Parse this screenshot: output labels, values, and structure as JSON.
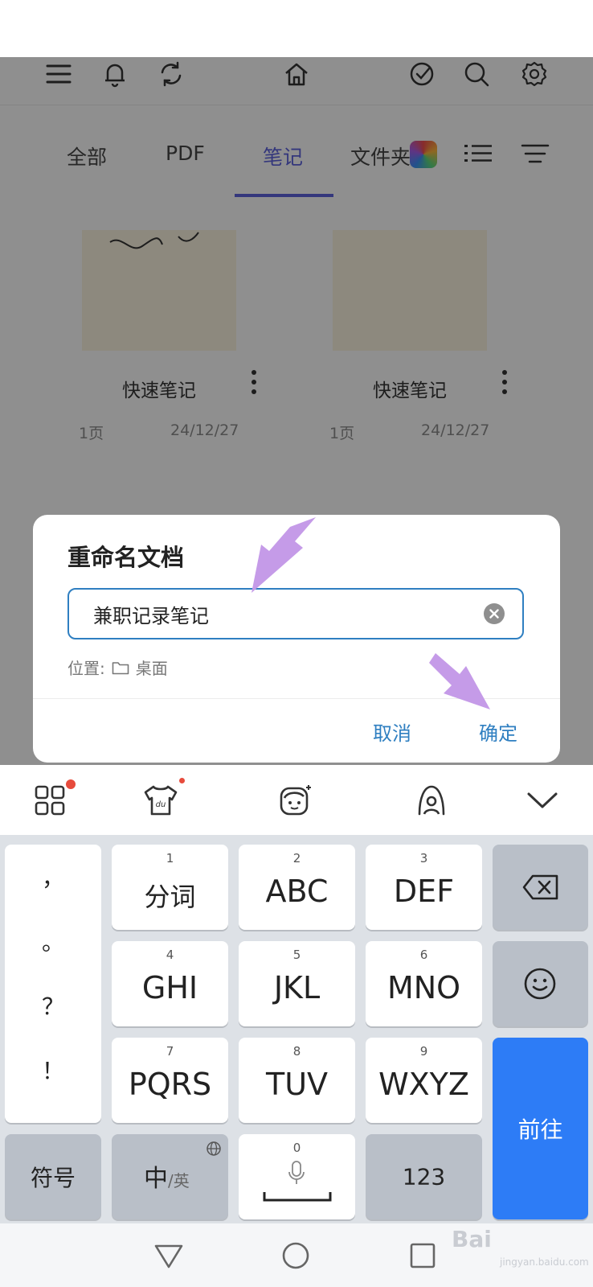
{
  "app": {
    "tabs": [
      {
        "label": "全部"
      },
      {
        "label": "PDF"
      },
      {
        "label": "笔记"
      },
      {
        "label": "文件夹"
      }
    ],
    "cards": [
      {
        "title": "快速笔记",
        "pages": "1页",
        "date": "24/12/27"
      },
      {
        "title": "快速笔记",
        "pages": "1页",
        "date": "24/12/27"
      }
    ]
  },
  "dialog": {
    "title": "重命名文档",
    "input_value": "兼职记录笔记",
    "location_label": "位置:",
    "location_value": "桌面",
    "cancel_label": "取消",
    "confirm_label": "确定"
  },
  "keyboard": {
    "punctuation": [
      "，",
      "。",
      "？",
      "！"
    ],
    "keys": [
      {
        "num": "1",
        "label": "分词"
      },
      {
        "num": "2",
        "label": "ABC"
      },
      {
        "num": "3",
        "label": "DEF"
      },
      {
        "num": "4",
        "label": "GHI"
      },
      {
        "num": "5",
        "label": "JKL"
      },
      {
        "num": "6",
        "label": "MNO"
      },
      {
        "num": "7",
        "label": "PQRS"
      },
      {
        "num": "8",
        "label": "TUV"
      },
      {
        "num": "9",
        "label": "WXYZ"
      }
    ],
    "symbol_label": "符号",
    "lang_main": "中",
    "lang_alt": "/英",
    "space_num": "0",
    "numbers_label": "123",
    "go_label": "前往"
  },
  "watermark": {
    "text": "Bai",
    "sub": "jingyan.baidu.com"
  },
  "colors": {
    "accent": "#5a5fd6",
    "link": "#2f7fc1",
    "go_key": "#2d7cf6",
    "arrow": "#c59be8"
  }
}
